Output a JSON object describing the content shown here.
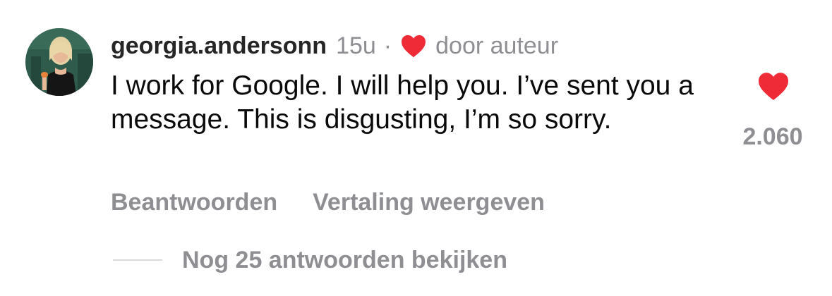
{
  "comment": {
    "username": "georgia.andersonn",
    "timestamp": "15u",
    "separator": "·",
    "author_badge": {
      "icon": "heart-icon",
      "color": "#ee2b36",
      "text": "door auteur"
    },
    "text": "I work for Google. I will help you. I’ve sent you a message. This is disgusting, I’m so sorry.",
    "like": {
      "icon": "heart-icon",
      "color": "#ee2b36",
      "liked": true,
      "count": "2.060"
    },
    "actions": {
      "reply": "Beantwoorden",
      "translate": "Vertaling weergeven"
    },
    "replies": {
      "label": "Nog 25 antwoorden bekijken"
    }
  },
  "colors": {
    "text": "#0a0a0a",
    "secondary_text": "#8e8e93",
    "divider": "#dbdbdb",
    "like_red": "#ee2b36"
  }
}
